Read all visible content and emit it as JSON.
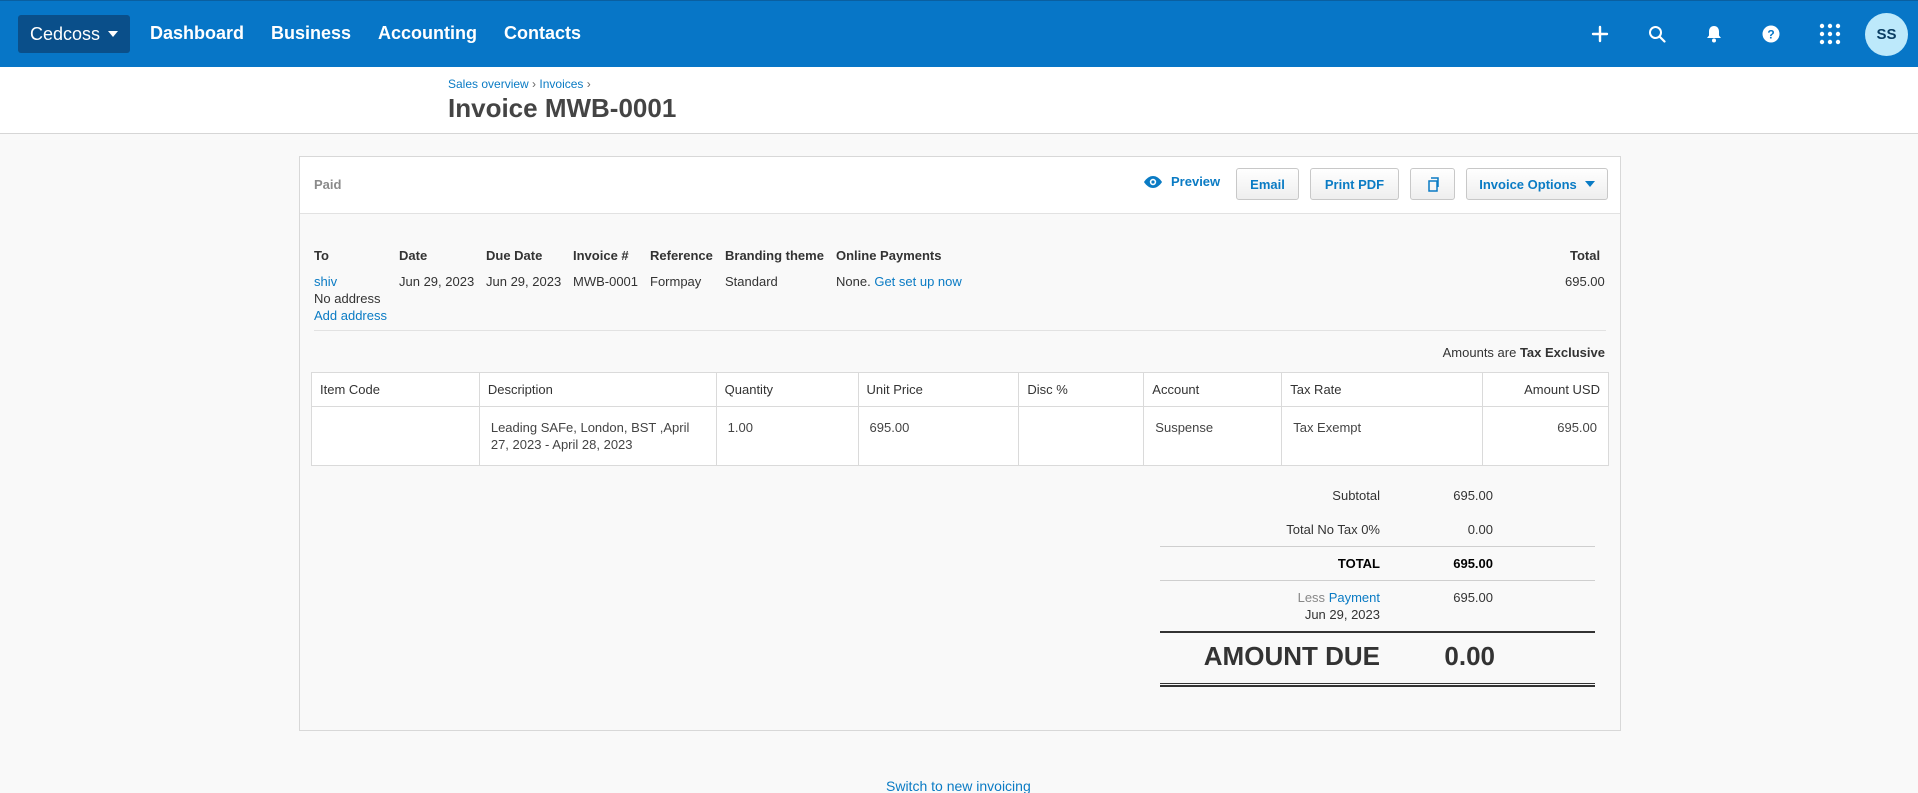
{
  "topbar": {
    "org": "Cedcoss",
    "nav": [
      "Dashboard",
      "Business",
      "Accounting",
      "Contacts"
    ],
    "icons": [
      "plus-icon",
      "search-icon",
      "bell-icon",
      "help-icon",
      "apps-grid-icon"
    ],
    "avatar": "SS"
  },
  "breadcrumb": {
    "sales_overview": "Sales overview",
    "invoices": "Invoices",
    "sep": "›"
  },
  "page_title": "Invoice MWB-0001",
  "toolbar": {
    "status": "Paid",
    "preview": "Preview",
    "email": "Email",
    "print_pdf": "Print PDF",
    "invoice_options": "Invoice Options"
  },
  "details": {
    "headers": {
      "to": "To",
      "date": "Date",
      "due_date": "Due Date",
      "invoice_no": "Invoice #",
      "reference": "Reference",
      "branding": "Branding theme",
      "online_payments": "Online Payments",
      "total": "Total"
    },
    "to_name": "shiv",
    "no_address": "No address",
    "add_address": "Add address",
    "date": "Jun 29, 2023",
    "due_date": "Jun 29, 2023",
    "invoice_no": "MWB-0001",
    "reference": "Formpay",
    "branding": "Standard",
    "online_payments_none": "None.",
    "get_set_up": "Get set up now",
    "total": "695.00"
  },
  "amounts_are": {
    "label": "Amounts are",
    "value": "Tax Exclusive"
  },
  "line_items": {
    "columns": [
      "Item Code",
      "Description",
      "Quantity",
      "Unit Price",
      "Disc %",
      "Account",
      "Tax Rate",
      "Amount USD"
    ],
    "rows": [
      {
        "item_code": "",
        "description": "Leading SAFe, London, BST ,April 27, 2023 - April 28, 2023",
        "quantity": "1.00",
        "unit_price": "695.00",
        "disc": "",
        "account": "Suspense",
        "tax_rate": "Tax Exempt",
        "amount": "695.00"
      }
    ]
  },
  "totals": {
    "subtotal_label": "Subtotal",
    "subtotal": "695.00",
    "tax_label": "Total No Tax 0%",
    "tax": "0.00",
    "total_label": "TOTAL",
    "total": "695.00",
    "less": "Less",
    "payment_label": "Payment",
    "payment_date": "Jun 29, 2023",
    "payment": "695.00",
    "amount_due_label": "AMOUNT DUE",
    "amount_due": "0.00"
  },
  "footer_link": "Switch to new invoicing",
  "colors": {
    "topbar": "#0776c7",
    "link": "#0a7bc4",
    "avatar": "#bde9fb"
  }
}
